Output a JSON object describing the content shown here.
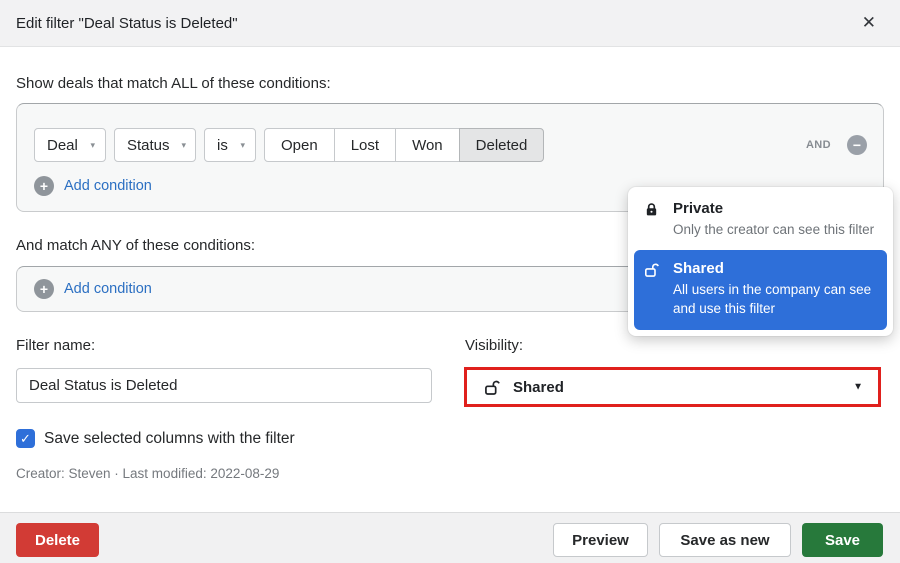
{
  "header": {
    "title": "Edit filter \"Deal Status is Deleted\""
  },
  "icons": {
    "close": "✕",
    "dropdown_caret": "▾",
    "select_caret": "▼",
    "add": "+",
    "remove": "−",
    "check": "✓"
  },
  "conditions_all": {
    "heading": "Show deals that match ALL of these conditions:",
    "row": {
      "object": "Deal",
      "field": "Status",
      "operator": "is",
      "options": [
        "Open",
        "Lost",
        "Won",
        "Deleted"
      ],
      "selected_option": "Deleted",
      "join_label": "AND"
    },
    "add_label": "Add condition"
  },
  "conditions_any": {
    "heading": "And match ANY of these conditions:",
    "add_label": "Add condition"
  },
  "filter_name": {
    "label": "Filter name:",
    "value": "Deal Status is Deleted"
  },
  "visibility": {
    "label": "Visibility:",
    "selected": "Shared",
    "options": [
      {
        "name": "Private",
        "description": "Only the creator can see this filter",
        "icon": "lock-closed-icon",
        "selected": false
      },
      {
        "name": "Shared",
        "description": "All users in the company can see and use this filter",
        "icon": "lock-open-icon",
        "selected": true
      }
    ]
  },
  "save_columns": {
    "label": "Save selected columns with the filter",
    "checked": true
  },
  "meta_line": "Creator: Steven · Last modified: 2022-08-29",
  "footer": {
    "delete_label": "Delete",
    "preview_label": "Preview",
    "save_as_new_label": "Save as new",
    "save_label": "Save"
  },
  "colors": {
    "accent_blue": "#2e6fd9",
    "link_blue": "#2b6fc2",
    "delete_red": "#d23b35",
    "save_green": "#27793b",
    "annotation_red": "#e0201d"
  }
}
